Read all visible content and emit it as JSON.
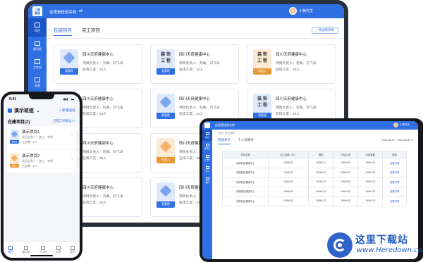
{
  "colors": {
    "primary": "#2f6fe4",
    "orange": "#e79a34",
    "frame": "#2b2f38"
  },
  "tablet": {
    "logo": "工装\n管理",
    "org_name": "这里是班组名称",
    "switch_icon": "swap-icon",
    "user_name": "小黄先生",
    "sidebar": [
      {
        "label": "项目",
        "icon": "project-icon",
        "active": true
      },
      {
        "label": "通讯录",
        "icon": "contacts-icon",
        "active": false
      },
      {
        "label": "工作台",
        "icon": "workbench-icon",
        "active": false
      },
      {
        "label": "消息",
        "icon": "message-icon",
        "active": false
      }
    ],
    "tabs": [
      {
        "label": "在建项目",
        "active": true
      },
      {
        "label": "完工项目",
        "active": false
      }
    ],
    "add_button": "+ 添加新项目",
    "cards": [
      {
        "title": "四川天府健康中心",
        "manager": "项目负责人：刘禹、刘飞洋",
        "workers": "在场工友：23人",
        "tag": "我管理",
        "variant": "blue",
        "thumb_text": ""
      },
      {
        "title": "四川天府健康中心",
        "manager": "项目负责人：刘禹、刘飞洋",
        "workers": "在场工友：23人",
        "tag": "我管理",
        "variant": "blue",
        "thumb_text": "装 饰\n工 程"
      },
      {
        "title": "四川天府健康中心",
        "manager": "项目负责人：刘禹、刘飞洋",
        "workers": "在场工友：23人",
        "tag": "我加入",
        "variant": "orange",
        "thumb_text": "装 饰\n工 程"
      },
      {
        "title": "四川天府健康中心",
        "manager": "项目负责人：刘禹、刘飞洋",
        "workers": "在场工友：23人",
        "tag": "我管理",
        "variant": "blue",
        "thumb_text": ""
      },
      {
        "title": "四川天府健康中心",
        "manager": "项目负责人：刘禹、刘飞洋",
        "workers": "在场工友：23人",
        "tag": "我管理",
        "variant": "blue",
        "thumb_text": ""
      },
      {
        "title": "四川天府健康中心",
        "manager": "项目负责人：刘禹、刘飞洋",
        "workers": "在场工友：23人",
        "tag": "我管理",
        "variant": "blue",
        "thumb_text": "装 饰\n工 程"
      },
      {
        "title": "四川天府健康中心",
        "manager": "项目负责人：刘禹、刘飞洋",
        "workers": "在场工友：23人",
        "tag": "我管理",
        "variant": "blue",
        "thumb_text": ""
      },
      {
        "title": "四川天府健康中心",
        "manager": "项目负责人：刘禹、刘飞洋",
        "workers": "在场工友：23人",
        "tag": "我加入",
        "variant": "orange",
        "thumb_text": ""
      },
      {
        "title": "",
        "manager": "",
        "workers": "",
        "tag": "",
        "variant": "blue",
        "thumb_text": ""
      },
      {
        "title": "四川天府健康中心",
        "manager": "项目负责人：刘禹、刘飞洋",
        "workers": "在场工友：23人",
        "tag": "我管理",
        "variant": "blue",
        "thumb_text": ""
      },
      {
        "title": "四川天府健康中心",
        "manager": "项目负责人：刘禹、刘飞洋",
        "workers": "在场工友：23人",
        "tag": "我管理",
        "variant": "blue",
        "thumb_text": ""
      },
      {
        "title": "",
        "manager": "",
        "workers": "",
        "tag": "",
        "variant": "blue",
        "thumb_text": ""
      }
    ]
  },
  "phone": {
    "time": "9:41",
    "status_right": "▮▮▮ ◔ ▬",
    "team": "演示班组",
    "team_chevron": "chevron-down-icon",
    "new_team": "+ 新建班组",
    "section": "在建项目(2)",
    "done_link": "已完工项目(1) >",
    "cards": [
      {
        "title": "演示项目1",
        "manager": "项目负责人：张三、李四",
        "workers": "工友数：8人",
        "tag": "我管理",
        "variant": "blue"
      },
      {
        "title": "演示项目2",
        "manager": "项目负责人：张三、李四",
        "workers": "工友数：8人",
        "tag": "我加入",
        "variant": "orange"
      }
    ],
    "tabbar": [
      {
        "label": "项目",
        "active": true
      },
      {
        "label": "通讯录",
        "active": false
      },
      {
        "label": "工作台",
        "active": false
      },
      {
        "label": "消息",
        "active": false
      },
      {
        "label": "我的",
        "active": false
      }
    ]
  },
  "mini": {
    "org_name": "这里是班组名称",
    "user_name": "小黄先生",
    "crumb": "项目 / 项目详情",
    "sidebar": [
      "项目",
      "通讯录",
      "工作台",
      "消息",
      "我的"
    ],
    "tabs": [
      {
        "label": "班组统计",
        "active": true
      },
      {
        "label": "个人员统计",
        "active": false
      }
    ],
    "date_range": "2022-08-01 ~ 2022-08-31 ▾",
    "columns": [
      "项目名称",
      "出工金额（元）",
      "借支",
      "已结工资",
      "未结金额",
      "操作"
    ],
    "rows": [
      [
        "天府新区健康中心",
        "19064.22",
        "19064.22",
        "19064.22",
        "19064.22",
        "查看详情"
      ],
      [
        "天府新区健康中心",
        "19064.22",
        "19064.22",
        "19064.22",
        "19064.22",
        "查看详情"
      ],
      [
        "天府新区健康中心",
        "19064.22",
        "19064.22",
        "19064.22",
        "19064.22",
        "查看详情"
      ],
      [
        "天府新区健康中心",
        "19064.22",
        "19064.22",
        "19064.22",
        "19064.22",
        "查看详情"
      ],
      [
        "天府新区健康中心",
        "19064.22",
        "19064.22",
        "19064.22",
        "19064.22",
        "查看详情"
      ]
    ]
  },
  "watermark": {
    "title": "这里下载站",
    "url": "www.Heredown.com"
  }
}
